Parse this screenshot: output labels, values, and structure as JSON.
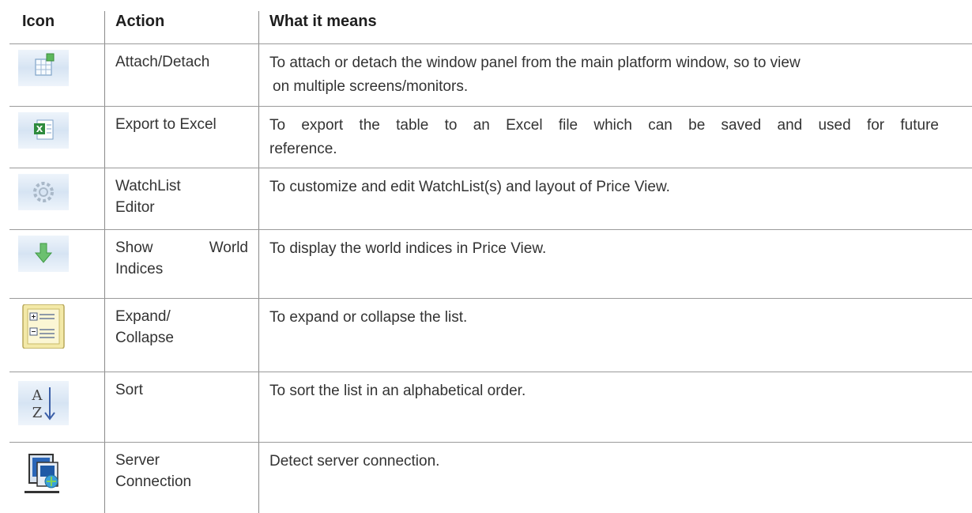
{
  "headers": {
    "icon": "Icon",
    "action": "Action",
    "meaning": "What it means"
  },
  "rows": [
    {
      "icon": "attach-detach-icon",
      "action": "Attach/Detach",
      "meaning": "To attach or detach the window panel from the main platform window, so to view",
      "meaning2": "on multiple screens/monitors."
    },
    {
      "icon": "export-excel-icon",
      "action": "Export to Excel",
      "meaning": "To export the table to an Excel file which can be saved and used for future",
      "meaning2": "reference."
    },
    {
      "icon": "gear-icon",
      "action": "WatchList",
      "action2": "Editor",
      "meaning": "To customize and edit WatchList(s) and layout of Price View."
    },
    {
      "icon": "arrow-down-icon",
      "action": "Show",
      "action_b": "World",
      "action2": "Indices",
      "meaning": "To display the world indices in Price View."
    },
    {
      "icon": "expand-collapse-icon",
      "action": "Expand/",
      "action2": "Collapse",
      "meaning": "To expand or collapse the list."
    },
    {
      "icon": "sort-az-icon",
      "action": "Sort",
      "meaning": "To sort the list in an alphabetical order."
    },
    {
      "icon": "server-connection-icon",
      "action": "Server",
      "action2": "Connection",
      "meaning": "Detect server connection."
    }
  ]
}
